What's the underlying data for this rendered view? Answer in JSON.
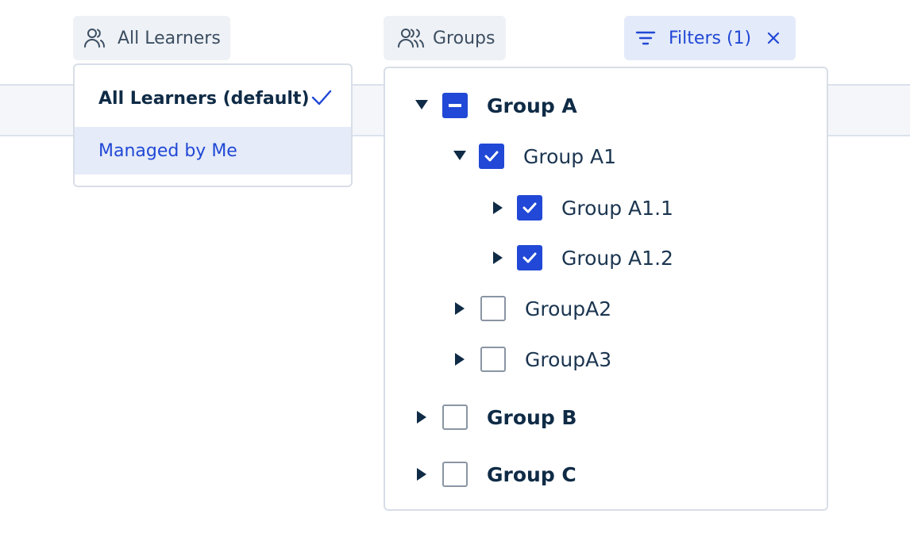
{
  "toolbar": {
    "learners_label": "All Learners",
    "groups_label": "Groups",
    "filters_label": "Filters (1)"
  },
  "learners_menu": {
    "items": [
      {
        "label": "All Learners (default)",
        "selected": true
      },
      {
        "label": "Managed by Me",
        "selected": false
      }
    ]
  },
  "groups_tree": {
    "nodes": [
      {
        "label": "Group A",
        "state": "indeterminate",
        "expanded": true
      },
      {
        "label": "Group A1",
        "state": "checked",
        "expanded": true
      },
      {
        "label": "Group A1.1",
        "state": "checked",
        "expanded": false
      },
      {
        "label": "Group A1.2",
        "state": "checked",
        "expanded": false
      },
      {
        "label": "GroupA2",
        "state": "unchecked",
        "expanded": false
      },
      {
        "label": "GroupA3",
        "state": "unchecked",
        "expanded": false
      },
      {
        "label": "Group B",
        "state": "unchecked",
        "expanded": false
      },
      {
        "label": "Group C",
        "state": "unchecked",
        "expanded": false
      }
    ]
  },
  "colors": {
    "accent": "#2148d6",
    "text": "#0f2b46",
    "chip_bg": "#eef1f5",
    "active_chip_bg": "#e3eaf9"
  }
}
